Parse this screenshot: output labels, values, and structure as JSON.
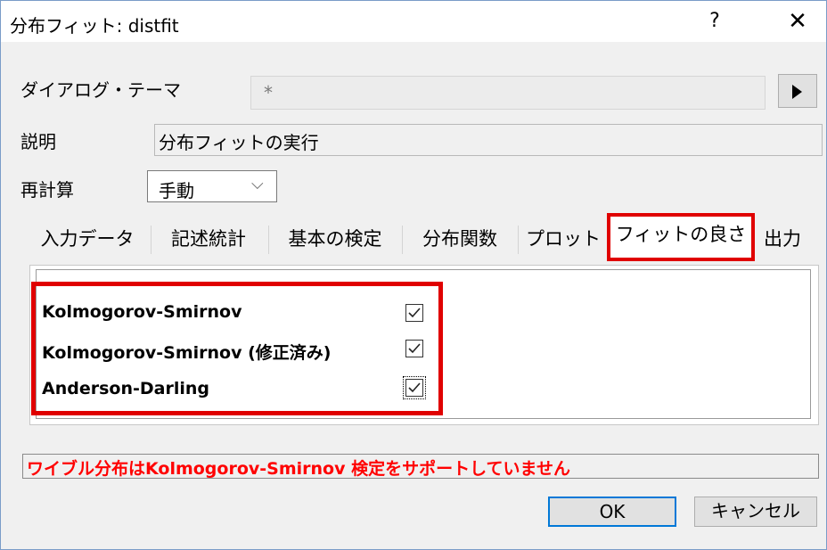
{
  "window": {
    "title": "分布フィット: distfit",
    "help_label": "?",
    "close_label": "✕"
  },
  "form": {
    "theme_label": "ダイアログ・テーマ",
    "theme_value": "*",
    "description_label": "説明",
    "description_value": "分布フィットの実行",
    "recalc_label": "再計算",
    "recalc_value": "手動"
  },
  "tabs": [
    "入力データ",
    "記述統計",
    "基本の検定",
    "分布関数",
    "プロット",
    "フィットの良さ",
    "出力"
  ],
  "active_tab": "フィットの良さ",
  "options": [
    {
      "label": "Kolmogorov-Smirnov",
      "checked": true
    },
    {
      "label": "Kolmogorov-Smirnov (修正済み)",
      "checked": true
    },
    {
      "label": "Anderson-Darling",
      "checked": true
    }
  ],
  "status_message": "ワイブル分布はKolmogorov-Smirnov 検定をサポートしていません",
  "buttons": {
    "ok": "OK",
    "cancel": "キャンセル"
  },
  "colors": {
    "highlight": "#e00000",
    "warning_text": "#ff0000",
    "focus": "#0078d7"
  }
}
